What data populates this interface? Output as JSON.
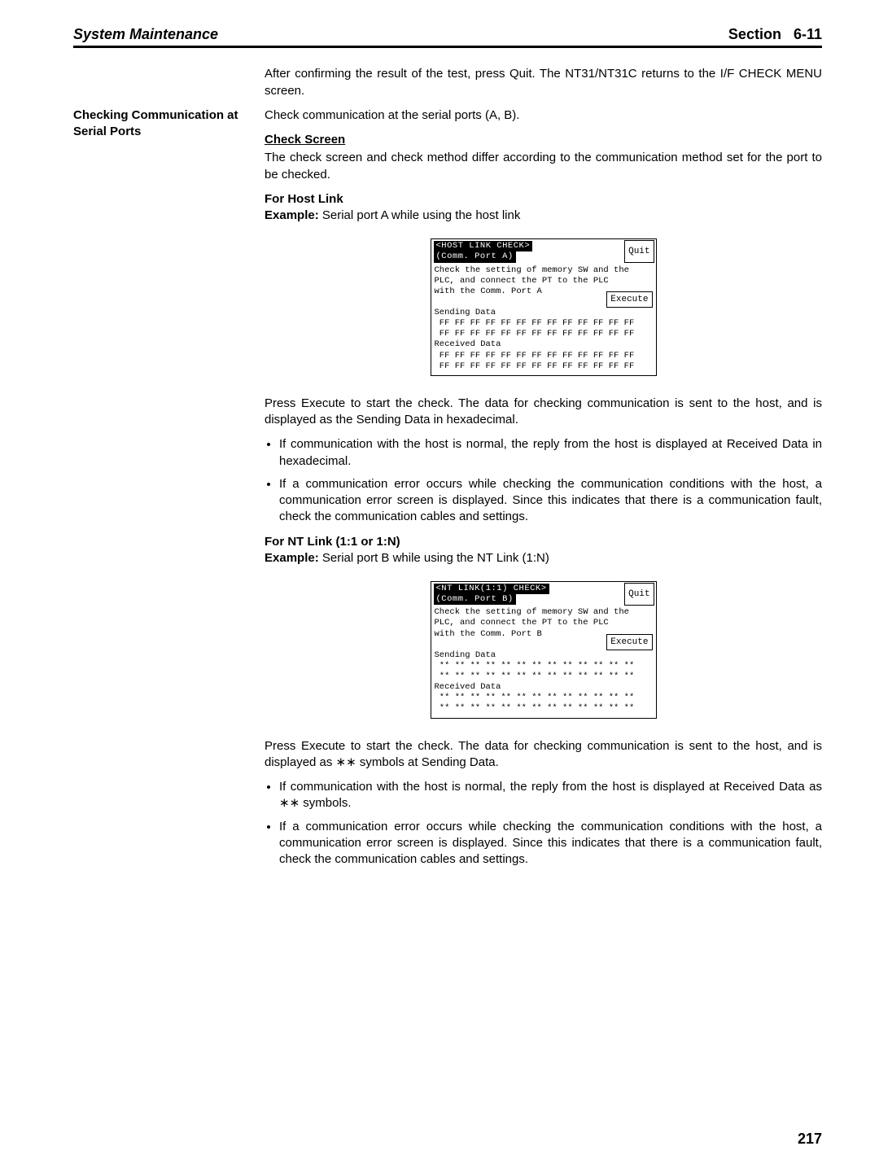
{
  "header": {
    "left": "System Maintenance",
    "section_label": "Section",
    "section_number": "6-11"
  },
  "intro_after_confirm": "After confirming the result of the test, press Quit. The NT31/NT31C returns to the I/F CHECK MENU screen.",
  "side_heading": "Checking Communication at Serial Ports",
  "check_comm_line": "Check communication at the serial ports (A, B).",
  "check_screen_heading": "Check Screen",
  "check_screen_para": "The check screen and check method differ according to the communication method set for the port to be checked.",
  "hostlink_heading": "For Host Link",
  "hostlink_example_label": "Example:",
  "hostlink_example_text": " Serial port A while using the host link",
  "screen1": {
    "title": "<HOST LINK CHECK>",
    "subtitle": "(Comm. Port A)",
    "quit": "Quit",
    "execute": "Execute",
    "instr1": "Check the setting of memory SW and the",
    "instr2": "PLC, and connect the PT to the PLC",
    "instr3": "with the Comm. Port A",
    "sending": "Sending Data",
    "row": " FF FF FF FF FF FF FF FF FF FF FF FF FF",
    "received": "Received Data"
  },
  "after_screen1": "Press Execute to start the check. The data for checking communication is sent to the host, and is displayed as the Sending Data in hexadecimal.",
  "bullets1": [
    "If communication with the host is normal, the reply from the host is displayed at Received Data in hexadecimal.",
    "If a communication error occurs while checking the communication conditions with the host, a communication error screen is displayed. Since this indicates that there is a communication fault, check the communication cables and settings."
  ],
  "ntlink_heading": "For NT Link (1:1 or 1:N)",
  "ntlink_example_label": "Example:",
  "ntlink_example_text": " Serial port B while using the NT Link (1:N)",
  "screen2": {
    "title": "<NT LINK(1:1) CHECK>",
    "subtitle": "(Comm. Port B)",
    "quit": "Quit",
    "execute": "Execute",
    "instr1": "Check the setting of memory SW and the",
    "instr2": "PLC, and connect the PT to the PLC",
    "instr3": "with the Comm. Port B",
    "sending": "Sending Data",
    "row": " ** ** ** ** ** ** ** ** ** ** ** ** **",
    "received": "Received Data"
  },
  "after_screen2": "Press Execute to start the check. The data for checking communication is sent to the host, and is displayed as ∗∗ symbols at Sending Data.",
  "bullets2": [
    "If communication with the host is normal, the reply from the host is displayed at Received Data as ∗∗ symbols.",
    "If a communication error occurs while checking the communication conditions with the host, a communication error screen is displayed. Since this indicates that there is a communication fault, check the communication cables and settings."
  ],
  "page_number": "217"
}
